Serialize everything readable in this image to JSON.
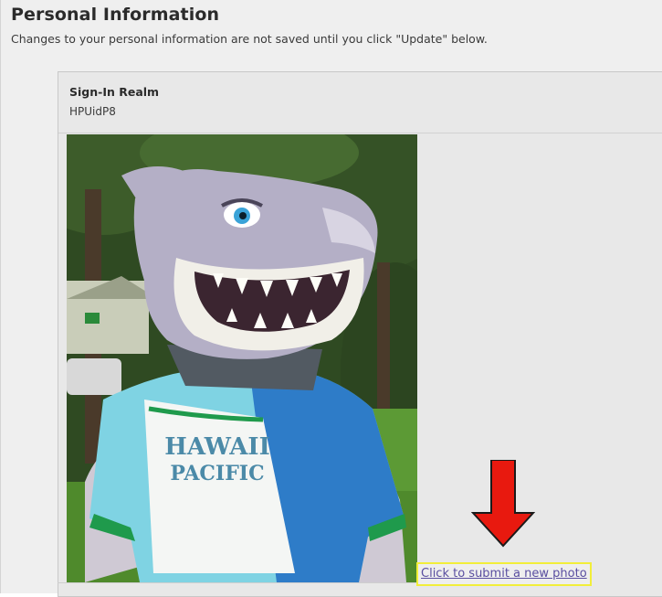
{
  "header": {
    "title": "Personal Information",
    "subtitle": "Changes to your personal information are not saved until you click \"Update\" below."
  },
  "realm": {
    "label": "Sign-In Realm",
    "value": "HPUidP8"
  },
  "photo": {
    "jersey_text_line1": "HAWAII",
    "jersey_text_line2": "PACIFIC"
  },
  "actions": {
    "submit_photo_label": "Click to submit a new photo"
  },
  "colors": {
    "arrow": "#e8190f",
    "link": "#5a4fa0",
    "link_highlight": "#f2ee3a"
  }
}
